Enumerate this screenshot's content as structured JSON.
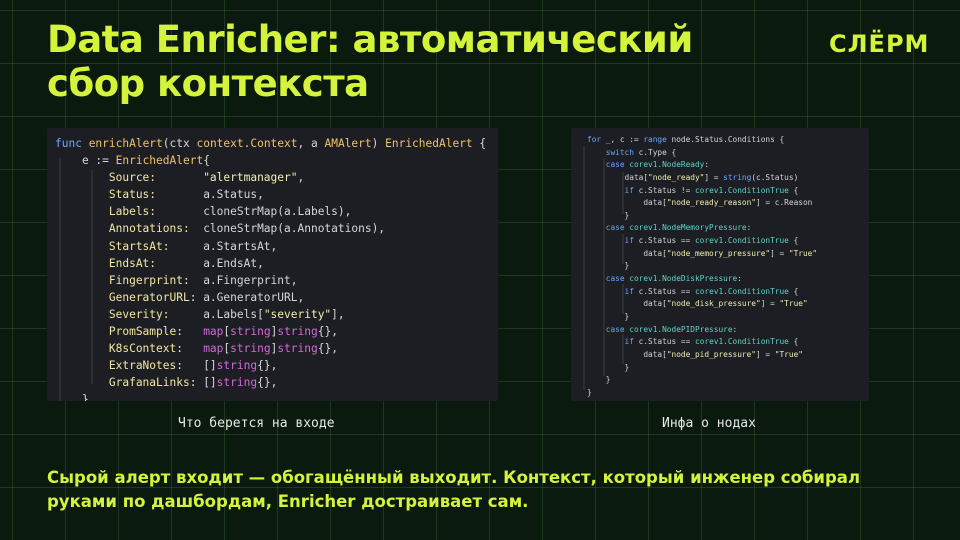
{
  "title": {
    "line1": "Data Enricher: автоматический",
    "line2": "сбор контекста"
  },
  "logo": "СЛЁРМ",
  "accent_color": "#d4f33b",
  "background_color": "#0b1a0e",
  "left_code": {
    "lines": [
      [
        [
          "kw",
          "func "
        ],
        [
          "fn",
          "enrichAlert"
        ],
        [
          "pl",
          "(ctx "
        ],
        [
          "ty",
          "context.Context"
        ],
        [
          "pl",
          ", a "
        ],
        [
          "ty",
          "AMAlert"
        ],
        [
          "pl",
          ") "
        ],
        [
          "ty",
          "EnrichedAlert"
        ],
        [
          "pl",
          " {"
        ]
      ],
      [
        [
          "pl",
          "    e := "
        ],
        [
          "ty",
          "EnrichedAlert"
        ],
        [
          "pl",
          "{"
        ]
      ],
      [
        [
          "fld",
          "        Source:       "
        ],
        [
          "str",
          "\"alertmanager\""
        ],
        [
          "pl",
          ","
        ]
      ],
      [
        [
          "fld",
          "        Status:       "
        ],
        [
          "pl",
          "a.Status,"
        ]
      ],
      [
        [
          "fld",
          "        Labels:       "
        ],
        [
          "pl",
          "cloneStrMap(a.Labels),"
        ]
      ],
      [
        [
          "fld",
          "        Annotations:  "
        ],
        [
          "pl",
          "cloneStrMap(a.Annotations),"
        ]
      ],
      [
        [
          "fld",
          "        StartsAt:     "
        ],
        [
          "pl",
          "a.StartsAt,"
        ]
      ],
      [
        [
          "fld",
          "        EndsAt:       "
        ],
        [
          "pl",
          "a.EndsAt,"
        ]
      ],
      [
        [
          "fld",
          "        Fingerprint:  "
        ],
        [
          "pl",
          "a.Fingerprint,"
        ]
      ],
      [
        [
          "fld",
          "        GeneratorURL: "
        ],
        [
          "pl",
          "a.GeneratorURL,"
        ]
      ],
      [
        [
          "fld",
          "        Severity:     "
        ],
        [
          "pl",
          "a.Labels["
        ],
        [
          "str",
          "\"severity\""
        ],
        [
          "pl",
          "],"
        ]
      ],
      [
        [
          "fld",
          "        PromSample:   "
        ],
        [
          "mag",
          "map"
        ],
        [
          "pl",
          "["
        ],
        [
          "mag",
          "string"
        ],
        [
          "pl",
          "]"
        ],
        [
          "mag",
          "string"
        ],
        [
          "pl",
          "{},"
        ]
      ],
      [
        [
          "fld",
          "        K8sContext:   "
        ],
        [
          "mag",
          "map"
        ],
        [
          "pl",
          "["
        ],
        [
          "mag",
          "string"
        ],
        [
          "pl",
          "]"
        ],
        [
          "mag",
          "string"
        ],
        [
          "pl",
          "{},"
        ]
      ],
      [
        [
          "fld",
          "        ExtraNotes:   "
        ],
        [
          "pl",
          "[]"
        ],
        [
          "mag",
          "string"
        ],
        [
          "pl",
          "{},"
        ]
      ],
      [
        [
          "fld",
          "        GrafanaLinks: "
        ],
        [
          "pl",
          "[]"
        ],
        [
          "mag",
          "string"
        ],
        [
          "pl",
          "{},"
        ]
      ],
      [
        [
          "pl",
          "    }"
        ]
      ]
    ]
  },
  "right_code": {
    "lines": [
      [
        [
          "kw",
          "for "
        ],
        [
          "pl",
          "_, c := "
        ],
        [
          "kw",
          "range "
        ],
        [
          "pl",
          "node.Status.Conditions {"
        ]
      ],
      [
        [
          "kw",
          "    switch "
        ],
        [
          "pl",
          "c.Type {"
        ]
      ],
      [
        [
          "kw",
          "    case "
        ],
        [
          "tyc",
          "corev1.NodeReady"
        ],
        [
          "pl",
          ":"
        ]
      ],
      [
        [
          "pl",
          "        data["
        ],
        [
          "str",
          "\"node_ready\""
        ],
        [
          "pl",
          "] = "
        ],
        [
          "kw",
          "string"
        ],
        [
          "pl",
          "(c.Status)"
        ]
      ],
      [
        [
          "kw",
          "        if "
        ],
        [
          "pl",
          "c.Status != "
        ],
        [
          "tyc",
          "corev1.ConditionTrue"
        ],
        [
          "pl",
          " {"
        ]
      ],
      [
        [
          "pl",
          "            data["
        ],
        [
          "str",
          "\"node_ready_reason\""
        ],
        [
          "pl",
          "] = c.Reason"
        ]
      ],
      [
        [
          "pl",
          "        }"
        ]
      ],
      [
        [
          "kw",
          "    case "
        ],
        [
          "tyc",
          "corev1.NodeMemoryPressure"
        ],
        [
          "pl",
          ":"
        ]
      ],
      [
        [
          "kw",
          "        if "
        ],
        [
          "pl",
          "c.Status == "
        ],
        [
          "tyc",
          "corev1.ConditionTrue"
        ],
        [
          "pl",
          " {"
        ]
      ],
      [
        [
          "pl",
          "            data["
        ],
        [
          "str",
          "\"node_memory_pressure\""
        ],
        [
          "pl",
          "] = "
        ],
        [
          "str",
          "\"True\""
        ]
      ],
      [
        [
          "pl",
          "        }"
        ]
      ],
      [
        [
          "kw",
          "    case "
        ],
        [
          "tyc",
          "corev1.NodeDiskPressure"
        ],
        [
          "pl",
          ":"
        ]
      ],
      [
        [
          "kw",
          "        if "
        ],
        [
          "pl",
          "c.Status == "
        ],
        [
          "tyc",
          "corev1.ConditionTrue"
        ],
        [
          "pl",
          " {"
        ]
      ],
      [
        [
          "pl",
          "            data["
        ],
        [
          "str",
          "\"node_disk_pressure\""
        ],
        [
          "pl",
          "] = "
        ],
        [
          "str",
          "\"True\""
        ]
      ],
      [
        [
          "pl",
          "        }"
        ]
      ],
      [
        [
          "kw",
          "    case "
        ],
        [
          "tyc",
          "corev1.NodePIDPressure"
        ],
        [
          "pl",
          ":"
        ]
      ],
      [
        [
          "kw",
          "        if "
        ],
        [
          "pl",
          "c.Status == "
        ],
        [
          "tyc",
          "corev1.ConditionTrue"
        ],
        [
          "pl",
          " {"
        ]
      ],
      [
        [
          "pl",
          "            data["
        ],
        [
          "str",
          "\"node_pid_pressure\""
        ],
        [
          "pl",
          "] = "
        ],
        [
          "str",
          "\"True\""
        ]
      ],
      [
        [
          "pl",
          "        }"
        ]
      ],
      [
        [
          "pl",
          "    }"
        ]
      ],
      [
        [
          "pl",
          "}"
        ]
      ]
    ]
  },
  "captions": {
    "left": "Что берется на входе",
    "right": "Инфа о нодах"
  },
  "bottom_text": {
    "line1": "Сырой алерт входит — обогащённый выходит. Контекст, который инженер собирал",
    "line2": "руками по дашбордам, Enricher достраивает сам."
  }
}
